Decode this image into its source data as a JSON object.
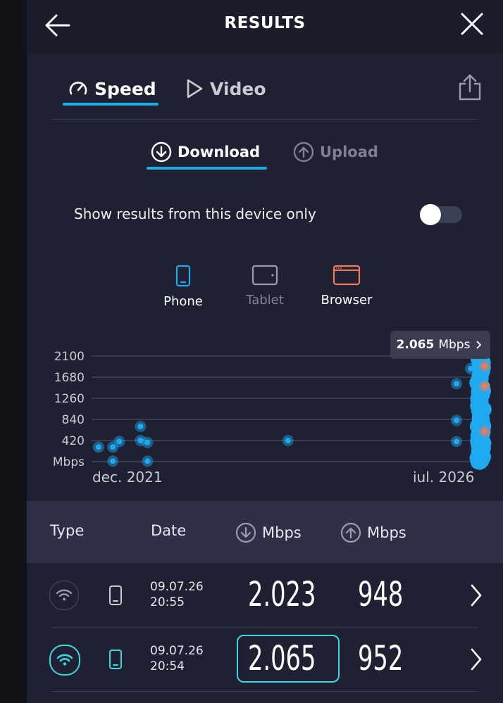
{
  "header": {
    "title": "RESULTS"
  },
  "tabs": [
    {
      "label": "Speed",
      "active": true
    },
    {
      "label": "Video",
      "active": false
    }
  ],
  "subtabs": [
    {
      "label": "Download",
      "active": true
    },
    {
      "label": "Upload",
      "active": false
    }
  ],
  "filter": {
    "label": "Show results from this device only",
    "enabled": false
  },
  "devices": [
    {
      "label": "Phone",
      "icon": "phone-icon",
      "color": "#1fa9f0",
      "active": true
    },
    {
      "label": "Tablet",
      "icon": "tablet-icon",
      "color": "#9a9cab",
      "active": false
    },
    {
      "label": "Browser",
      "icon": "browser-icon",
      "color": "#f07a5a",
      "active": true
    }
  ],
  "tooltip": {
    "value": "2.065",
    "unit": "Mbps"
  },
  "chart_data": {
    "type": "scatter",
    "y_ticks": [
      "2100",
      "1680",
      "1260",
      "840",
      "420"
    ],
    "y_unit_label": "Mbps",
    "ylim": [
      0,
      2100
    ],
    "x_start_label": "dec. 2021",
    "x_end_label": "iul. 2026",
    "grid": true,
    "series": [
      {
        "color": "#1fa9f0",
        "points": [
          [
            "2021-12",
            290
          ],
          [
            "2022-02",
            10
          ],
          [
            "2022-02",
            290
          ],
          [
            "2022-03",
            400
          ],
          [
            "2022-06",
            700
          ],
          [
            "2022-06",
            420
          ],
          [
            "2022-07",
            380
          ],
          [
            "2022-07",
            10
          ],
          [
            "2024-03",
            420
          ],
          [
            "2026-03",
            400
          ],
          [
            "2026-03",
            820
          ],
          [
            "2026-03",
            1550
          ],
          [
            "2026-05",
            1850
          ],
          [
            "2026-06",
            1300
          ],
          [
            "2026-06",
            980
          ]
        ]
      },
      {
        "color": "#f07a5a",
        "points": [
          [
            "2026-07",
            1900
          ],
          [
            "2026-07",
            1500
          ],
          [
            "2026-07",
            600
          ]
        ]
      }
    ]
  },
  "table": {
    "headers": {
      "type": "Type",
      "date": "Date",
      "download": "Mbps",
      "upload": "Mbps"
    },
    "rows": [
      {
        "connection": "wifi-icon",
        "device": "phone-icon",
        "date": "09.07.26",
        "time": "20:55",
        "download": "2.023",
        "upload": "948",
        "highlighted": false
      },
      {
        "connection": "wifi-icon",
        "device": "phone-icon",
        "date": "09.07.26",
        "time": "20:54",
        "download": "2.065",
        "upload": "952",
        "highlighted": true
      }
    ]
  }
}
